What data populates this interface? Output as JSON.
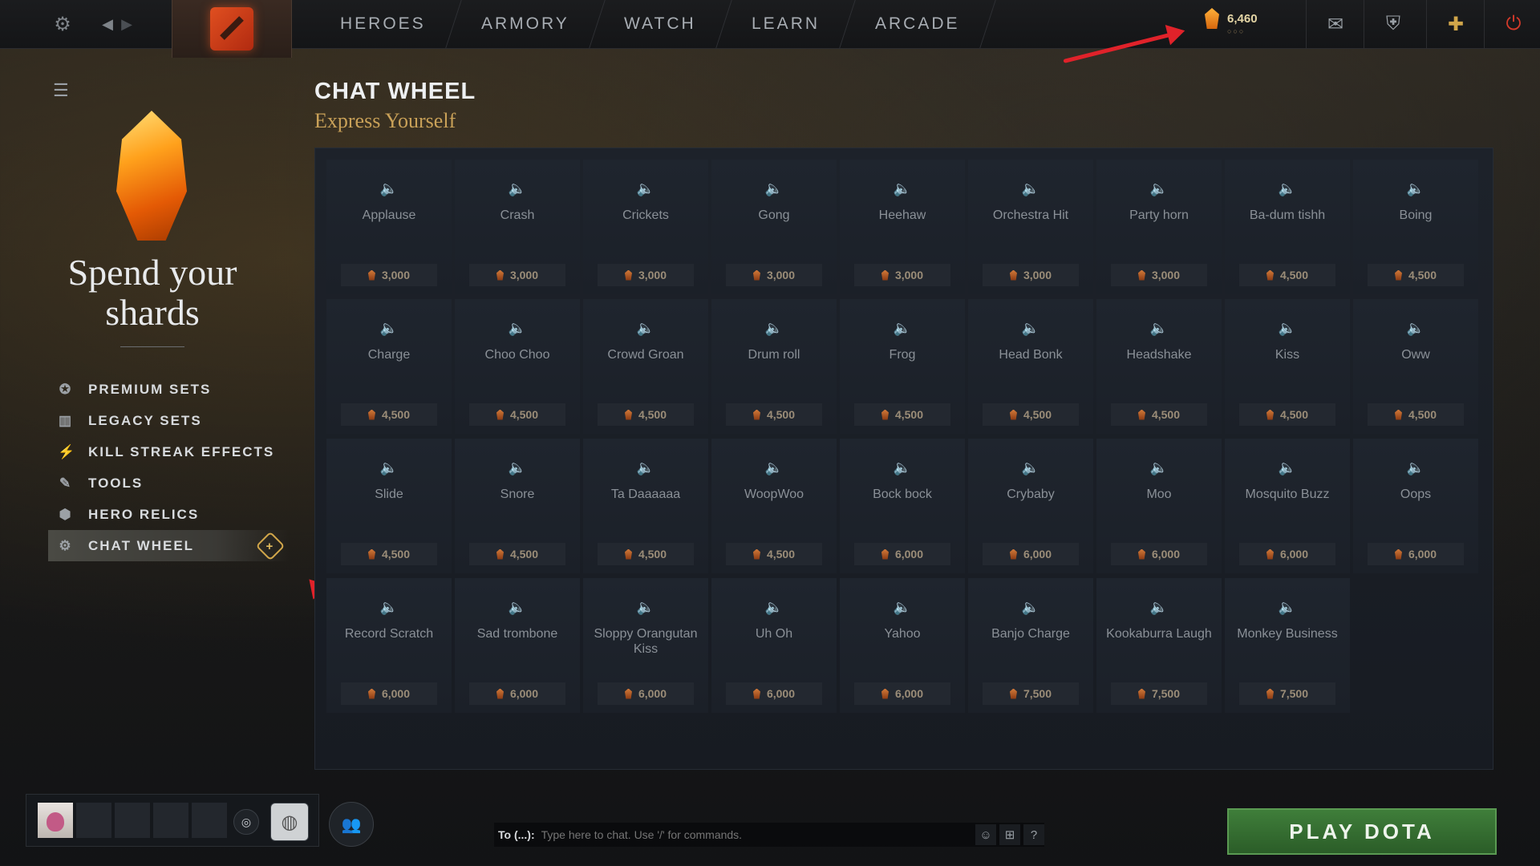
{
  "topbar": {
    "nav": [
      "HEROES",
      "ARMORY",
      "WATCH",
      "LEARN",
      "ARCADE"
    ],
    "shards": "6,460",
    "shard_dots": "○○○"
  },
  "sidebar": {
    "heading_line1": "Spend your",
    "heading_line2": "shards",
    "items": [
      {
        "label": "PREMIUM SETS",
        "icon": "star-badge-icon"
      },
      {
        "label": "LEGACY SETS",
        "icon": "sets-icon"
      },
      {
        "label": "KILL STREAK EFFECTS",
        "icon": "streak-icon"
      },
      {
        "label": "TOOLS",
        "icon": "tool-icon"
      },
      {
        "label": "HERO RELICS",
        "icon": "relic-icon"
      },
      {
        "label": "CHAT WHEEL",
        "icon": "gear-icon"
      }
    ]
  },
  "page": {
    "title": "CHAT WHEEL",
    "subtitle": "Express Yourself"
  },
  "items": [
    {
      "name": "Applause",
      "price": "3,000"
    },
    {
      "name": "Crash",
      "price": "3,000"
    },
    {
      "name": "Crickets",
      "price": "3,000"
    },
    {
      "name": "Gong",
      "price": "3,000"
    },
    {
      "name": "Heehaw",
      "price": "3,000"
    },
    {
      "name": "Orchestra Hit",
      "price": "3,000"
    },
    {
      "name": "Party horn",
      "price": "3,000"
    },
    {
      "name": "Ba-dum tishh",
      "price": "4,500"
    },
    {
      "name": "Boing",
      "price": "4,500"
    },
    {
      "name": "Charge",
      "price": "4,500"
    },
    {
      "name": "Choo Choo",
      "price": "4,500"
    },
    {
      "name": "Crowd Groan",
      "price": "4,500"
    },
    {
      "name": "Drum roll",
      "price": "4,500"
    },
    {
      "name": "Frog",
      "price": "4,500"
    },
    {
      "name": "Head Bonk",
      "price": "4,500"
    },
    {
      "name": "Headshake",
      "price": "4,500"
    },
    {
      "name": "Kiss",
      "price": "4,500"
    },
    {
      "name": "Oww",
      "price": "4,500"
    },
    {
      "name": "Slide",
      "price": "4,500"
    },
    {
      "name": "Snore",
      "price": "4,500"
    },
    {
      "name": "Ta Daaaaaa",
      "price": "4,500"
    },
    {
      "name": "WoopWoo",
      "price": "4,500"
    },
    {
      "name": "Bock bock",
      "price": "6,000"
    },
    {
      "name": "Crybaby",
      "price": "6,000"
    },
    {
      "name": "Moo",
      "price": "6,000"
    },
    {
      "name": "Mosquito Buzz",
      "price": "6,000"
    },
    {
      "name": "Oops",
      "price": "6,000"
    },
    {
      "name": "Record Scratch",
      "price": "6,000"
    },
    {
      "name": "Sad trombone",
      "price": "6,000"
    },
    {
      "name": "Sloppy Orangutan Kiss",
      "price": "6,000"
    },
    {
      "name": "Uh Oh",
      "price": "6,000"
    },
    {
      "name": "Yahoo",
      "price": "6,000"
    },
    {
      "name": "Banjo Charge",
      "price": "7,500"
    },
    {
      "name": "Kookaburra Laugh",
      "price": "7,500"
    },
    {
      "name": "Monkey Business",
      "price": "7,500"
    }
  ],
  "chat": {
    "prefix": "To (...):",
    "placeholder": "Type here to chat. Use '/' for commands."
  },
  "play_button": "PLAY DOTA",
  "colors": {
    "accent_gold": "#c9a158",
    "play_green": "#3f7e3a",
    "annotation_red": "#e0222a"
  }
}
